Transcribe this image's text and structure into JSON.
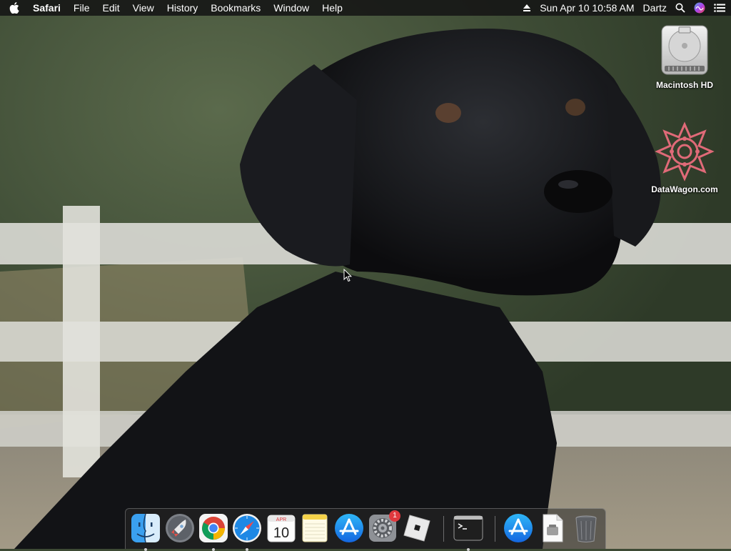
{
  "menubar": {
    "app_name": "Safari",
    "menus": [
      "File",
      "Edit",
      "View",
      "History",
      "Bookmarks",
      "Window",
      "Help"
    ],
    "clock": "Sun Apr 10  10:58 AM",
    "user": "Dartz"
  },
  "desktop": {
    "icons": [
      {
        "label": "Macintosh HD",
        "icon": "hard-drive-icon"
      },
      {
        "label": "DataWagon.com",
        "icon": "datawagon-icon"
      }
    ],
    "wallpaper": "black-labrador-photo"
  },
  "dock": {
    "items": [
      {
        "name": "finder",
        "icon": "finder-icon",
        "running": true
      },
      {
        "name": "launchpad",
        "icon": "launchpad-icon",
        "running": false
      },
      {
        "name": "chrome",
        "icon": "chrome-icon",
        "running": true
      },
      {
        "name": "safari",
        "icon": "safari-icon",
        "running": true
      },
      {
        "name": "calendar",
        "icon": "calendar-icon",
        "running": false,
        "month": "APR",
        "day": "10"
      },
      {
        "name": "notes",
        "icon": "notes-icon",
        "running": false
      },
      {
        "name": "app-store",
        "icon": "app-store-icon",
        "running": false
      },
      {
        "name": "system-preferences",
        "icon": "system-preferences-icon",
        "running": false,
        "badge": "1"
      },
      {
        "name": "roblox",
        "icon": "roblox-icon",
        "running": false
      },
      {
        "name": "terminal",
        "icon": "terminal-icon",
        "running": true
      },
      {
        "name": "app-store-installer",
        "icon": "app-store-icon",
        "running": false
      },
      {
        "name": "preview-doc",
        "icon": "document-icon",
        "running": false
      },
      {
        "name": "trash",
        "icon": "trash-icon",
        "running": false
      }
    ]
  },
  "colors": {
    "menubar_bg": "#141414",
    "badge": "#e0393e",
    "accent_blue": "#1e88e5"
  }
}
